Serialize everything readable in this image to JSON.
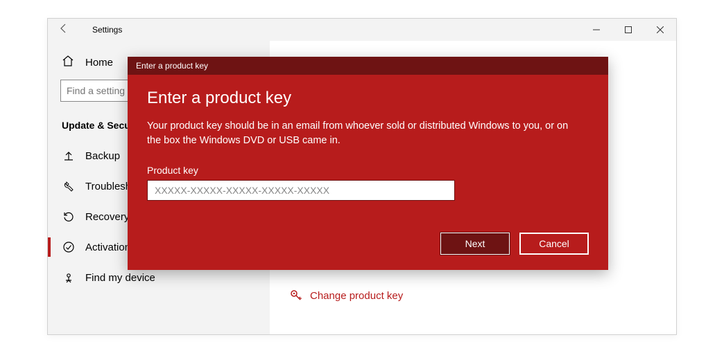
{
  "window": {
    "title": "Settings"
  },
  "sidebar": {
    "home_label": "Home",
    "search_placeholder": "Find a setting",
    "category_title": "Update & Security",
    "items": [
      {
        "label": "Backup"
      },
      {
        "label": "Troubleshoot"
      },
      {
        "label": "Recovery"
      },
      {
        "label": "Activation"
      },
      {
        "label": "Find my device"
      }
    ]
  },
  "main": {
    "change_key_label": "Change product key"
  },
  "dialog": {
    "window_title": "Enter a product key",
    "heading": "Enter a product key",
    "description": "Your product key should be in an email from whoever sold or distributed Windows to you, or on the box the Windows DVD or USB came in.",
    "field_label": "Product key",
    "input_placeholder": "XXXXX-XXXXX-XXXXX-XXXXX-XXXXX",
    "input_value": "",
    "next_label": "Next",
    "cancel_label": "Cancel"
  }
}
